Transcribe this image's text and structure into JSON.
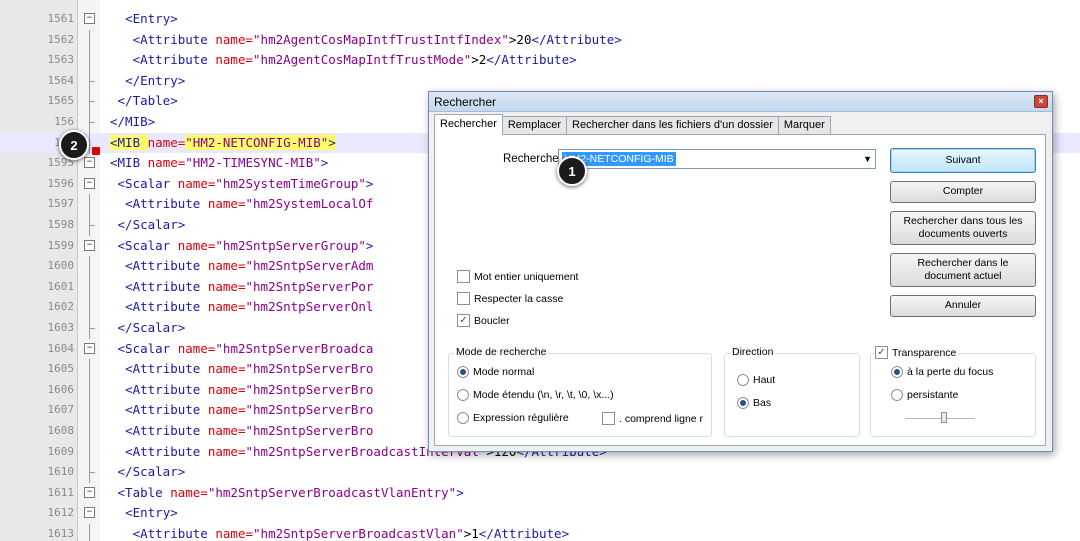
{
  "editor": {
    "lines": [
      {
        "n": "1561",
        "indent": "  ",
        "tag_open": "<Entry>",
        "attr": "",
        "value": "",
        "text": "",
        "tag_close": ""
      },
      {
        "n": "1562",
        "indent": "   ",
        "tag_open": "<Attribute ",
        "attr": "name=",
        "value": "\"hm2AgentCosMapIntfTrustIntfIndex\"",
        "text": ">20",
        "tag_close": "</Attribute>"
      },
      {
        "n": "1563",
        "indent": "   ",
        "tag_open": "<Attribute ",
        "attr": "name=",
        "value": "\"hm2AgentCosMapIntfTrustMode\"",
        "text": ">2",
        "tag_close": "</Attribute>"
      },
      {
        "n": "1564",
        "indent": "  ",
        "tag_open": "</Entry>",
        "attr": "",
        "value": "",
        "text": "",
        "tag_close": ""
      },
      {
        "n": "1565",
        "indent": " ",
        "tag_open": "</Table>",
        "attr": "",
        "value": "",
        "text": "",
        "tag_close": ""
      },
      {
        "n": "156",
        "indent": "",
        "tag_open": "</MIB>",
        "attr": "",
        "value": "",
        "text": "",
        "tag_close": ""
      },
      {
        "n": "156",
        "indent": "",
        "tag_open": "<MIB ",
        "attr": "name=",
        "value": "\"HM2-NETCONFIG-MIB\"",
        "text": "",
        "tag_close": ">"
      },
      {
        "n": "1595",
        "indent": "",
        "tag_open": "<MIB ",
        "attr": "name=",
        "value": "\"HM2-TIMESYNC-MIB\"",
        "text": "",
        "tag_close": ">"
      },
      {
        "n": "1596",
        "indent": " ",
        "tag_open": "<Scalar ",
        "attr": "name=",
        "value": "\"hm2SystemTimeGroup\"",
        "text": "",
        "tag_close": ">"
      },
      {
        "n": "1597",
        "indent": "  ",
        "tag_open": "<Attribute ",
        "attr": "name=",
        "value": "\"hm2SystemLocalOf",
        "text": "",
        "tag_close": ""
      },
      {
        "n": "1598",
        "indent": " ",
        "tag_open": "</Scalar>",
        "attr": "",
        "value": "",
        "text": "",
        "tag_close": ""
      },
      {
        "n": "1599",
        "indent": " ",
        "tag_open": "<Scalar ",
        "attr": "name=",
        "value": "\"hm2SntpServerGroup\"",
        "text": "",
        "tag_close": ">"
      },
      {
        "n": "1600",
        "indent": "  ",
        "tag_open": "<Attribute ",
        "attr": "name=",
        "value": "\"hm2SntpServerAdm",
        "text": "",
        "tag_close": ""
      },
      {
        "n": "1601",
        "indent": "  ",
        "tag_open": "<Attribute ",
        "attr": "name=",
        "value": "\"hm2SntpServerPor",
        "text": "",
        "tag_close": ""
      },
      {
        "n": "1602",
        "indent": "  ",
        "tag_open": "<Attribute ",
        "attr": "name=",
        "value": "\"hm2SntpServerOnl",
        "text": "",
        "tag_close": ""
      },
      {
        "n": "1603",
        "indent": " ",
        "tag_open": "</Scalar>",
        "attr": "",
        "value": "",
        "text": "",
        "tag_close": ""
      },
      {
        "n": "1604",
        "indent": " ",
        "tag_open": "<Scalar ",
        "attr": "name=",
        "value": "\"hm2SntpServerBroadca",
        "text": "",
        "tag_close": ""
      },
      {
        "n": "1605",
        "indent": "  ",
        "tag_open": "<Attribute ",
        "attr": "name=",
        "value": "\"hm2SntpServerBro",
        "text": "",
        "tag_close": ""
      },
      {
        "n": "1606",
        "indent": "  ",
        "tag_open": "<Attribute ",
        "attr": "name=",
        "value": "\"hm2SntpServerBro",
        "text": "",
        "tag_close": ""
      },
      {
        "n": "1607",
        "indent": "  ",
        "tag_open": "<Attribute ",
        "attr": "name=",
        "value": "\"hm2SntpServerBro",
        "text": "",
        "tag_close": ""
      },
      {
        "n": "1608",
        "indent": "  ",
        "tag_open": "<Attribute ",
        "attr": "name=",
        "value": "\"hm2SntpServerBro",
        "text": "",
        "tag_close": ""
      },
      {
        "n": "1609",
        "indent": "  ",
        "tag_open": "<Attribute ",
        "attr": "name=",
        "value": "\"hm2SntpServerBroadcastInterval\"",
        "text": ">120",
        "tag_close": "</Attribute>"
      },
      {
        "n": "1610",
        "indent": " ",
        "tag_open": "</Scalar>",
        "attr": "",
        "value": "",
        "text": "",
        "tag_close": ""
      },
      {
        "n": "1611",
        "indent": " ",
        "tag_open": "<Table ",
        "attr": "name=",
        "value": "\"hm2SntpServerBroadcastVlanEntry\"",
        "text": "",
        "tag_close": ">"
      },
      {
        "n": "1612",
        "indent": "  ",
        "tag_open": "<Entry>",
        "attr": "",
        "value": "",
        "text": "",
        "tag_close": ""
      },
      {
        "n": "1613",
        "indent": "   ",
        "tag_open": "<Attribute ",
        "attr": "name=",
        "value": "\"hm2SntpServerBroadcastVlan\"",
        "text": ">1",
        "tag_close": "</Attribute>"
      }
    ]
  },
  "dialog": {
    "title": "Rechercher",
    "close_glyph": "×",
    "tabs": [
      "Rechercher",
      "Remplacer",
      "Rechercher dans les fichiers d'un dossier",
      "Marquer"
    ],
    "search_label": "Recherche :",
    "search_value": "HM2-NETCONFIG-MIB",
    "combo_arrow": "▼",
    "buttons": {
      "next": "Suivant",
      "count": "Compter",
      "find_all_open": "Rechercher dans tous les documents ouverts",
      "find_current": "Rechercher dans le document actuel",
      "cancel": "Annuler"
    },
    "options": {
      "whole_word": "Mot entier uniquement",
      "match_case": "Respecter la casse",
      "wrap": "Boucler",
      "check_glyph": "✓"
    },
    "search_mode": {
      "title": "Mode de recherche",
      "normal": "Mode normal",
      "extended": "Mode étendu (\\n, \\r, \\t, \\0, \\x...)",
      "regex": "Expression régulière",
      "newline": ". comprend ligne r"
    },
    "direction": {
      "title": "Direction",
      "up": "Haut",
      "down": "Bas"
    },
    "transparency": {
      "title": "Transparence",
      "on_focus_loss": "à la perte du focus",
      "persistent": "persistante",
      "level": 0.55
    }
  },
  "callouts": {
    "one": "1",
    "two": "2"
  }
}
